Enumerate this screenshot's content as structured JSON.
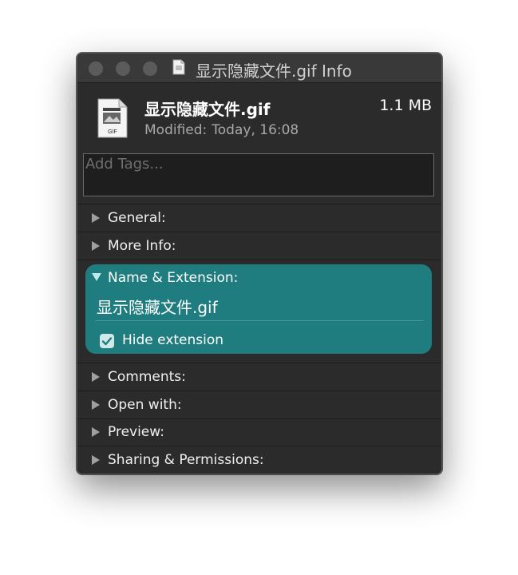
{
  "window": {
    "title": "显示隐藏文件.gif Info"
  },
  "header": {
    "file_name": "显示隐藏文件.gif",
    "file_size": "1.1 MB",
    "modified_label": "Modified:",
    "modified_value": "Today, 16:08",
    "file_icon_label": "GIF"
  },
  "tags": {
    "placeholder": "Add Tags..."
  },
  "sections": {
    "general": "General:",
    "more_info": "More Info:",
    "name_extension": "Name & Extension:",
    "comments": "Comments:",
    "open_with": "Open with:",
    "preview": "Preview:",
    "sharing": "Sharing & Permissions:"
  },
  "name_extension": {
    "name_value": "显示隐藏文件.gif",
    "hide_extension_label": "Hide extension",
    "hide_extension_checked": true
  },
  "colors": {
    "accent": "#1f7d7f",
    "window_bg": "#2b2b2b"
  }
}
